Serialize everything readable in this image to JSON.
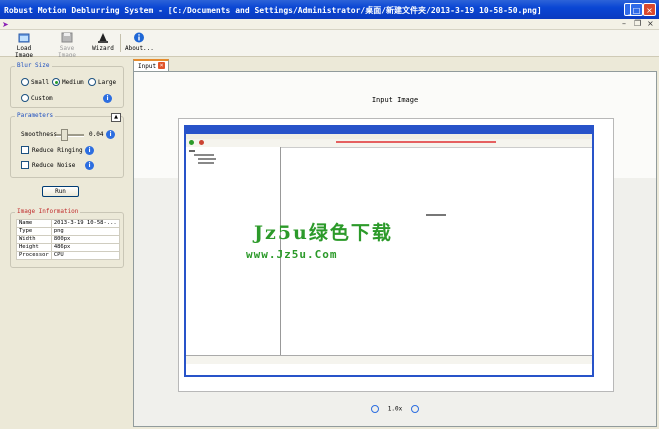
{
  "window": {
    "title": "Robust Motion Deblurring System - [C:/Documents and Settings/Administrator/桌面/新建文件夹/2013-3-19 10-58-50.png]",
    "minimize": "_",
    "maximize": "□",
    "close": "×"
  },
  "mdi": {
    "minimize": "–",
    "restore": "❐",
    "close": "×"
  },
  "toolbar": {
    "load_image": "Load Image",
    "save_image": "Save Image",
    "wizard": "Wizard",
    "about": "About..."
  },
  "blur_size": {
    "title": "Blur Size",
    "small": "Small",
    "medium": "Medium",
    "large": "Large",
    "custom": "Custom",
    "selected": "Medium"
  },
  "parameters": {
    "title": "Parameters",
    "smoothness_label": "Smoothness",
    "smoothness_value": "0.04",
    "reduce_ringing": "Reduce Ringing",
    "reduce_noise": "Reduce Noise"
  },
  "run_button": "Run",
  "image_info": {
    "title": "Image Information",
    "rows": [
      {
        "key": "Name",
        "value": "2013-3-19 10-58-..."
      },
      {
        "key": "Type",
        "value": "png"
      },
      {
        "key": "Width",
        "value": "800px"
      },
      {
        "key": "Height",
        "value": "486px"
      },
      {
        "key": "Processor",
        "value": "CPU"
      }
    ]
  },
  "tab": {
    "label": "Input",
    "close": "×"
  },
  "canvas": {
    "heading": "Input Image",
    "zoom_value": "1.0x",
    "watermark_main": "Jz5u绿色下载",
    "watermark_url": "www.Jz5u.Com"
  },
  "colors": {
    "titlebar": "#0a46d4",
    "accent": "#2d6ee0",
    "watermark": "#2c9a2a",
    "tab_highlight": "#e68b2c"
  }
}
